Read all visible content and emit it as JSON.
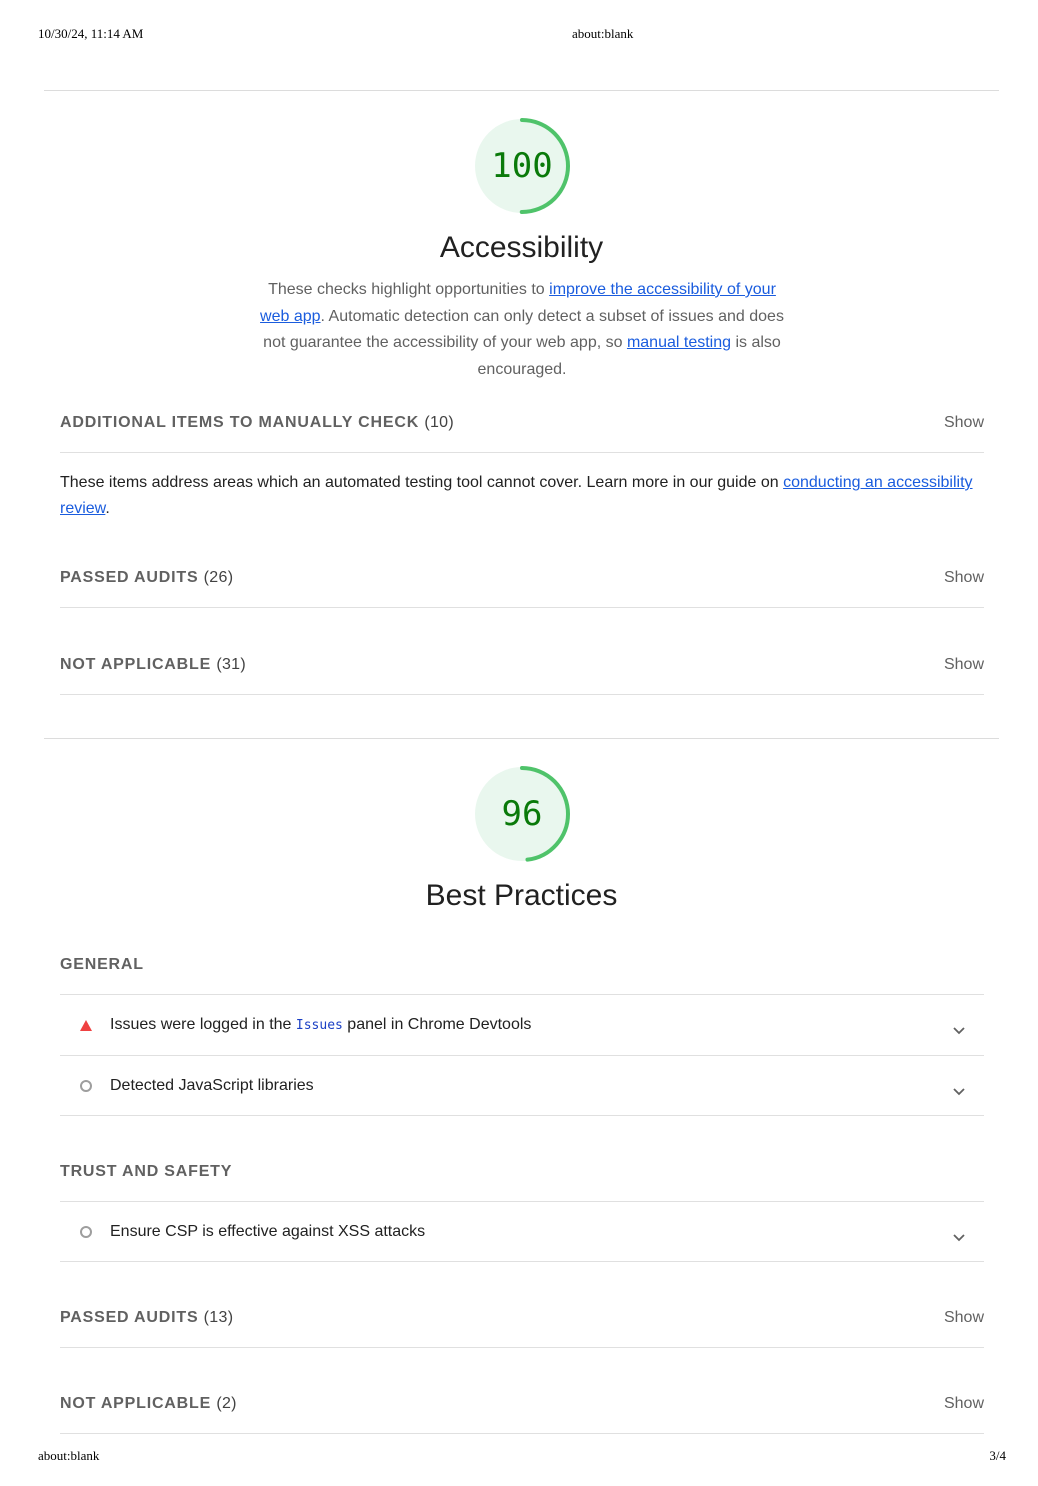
{
  "print_header": {
    "timestamp": "10/30/24, 11:14 AM",
    "url": "about:blank"
  },
  "print_footer": {
    "url": "about:blank",
    "page": "3/4"
  },
  "accessibility": {
    "score": "100",
    "score_fraction": 1.0,
    "title": "Accessibility",
    "desc_1": "These checks highlight opportunities to ",
    "desc_link_1": "improve the accessibility of your web app",
    "desc_2": ". Automatic detection can only detect a subset of issues and does not guarantee the accessibility of your web app, so ",
    "desc_link_2": "manual testing",
    "desc_3": " is also encouraged.",
    "manual": {
      "title": "ADDITIONAL ITEMS TO MANUALLY CHECK",
      "count": "(10)",
      "show": "Show"
    },
    "manual_desc_1": "These items address areas which an automated testing tool cannot cover. Learn more in our guide on ",
    "manual_desc_link": "conducting an accessibility review",
    "manual_desc_2": ".",
    "passed": {
      "title": "PASSED AUDITS",
      "count": "(26)",
      "show": "Show"
    },
    "not_applicable": {
      "title": "NOT APPLICABLE",
      "count": "(31)",
      "show": "Show"
    }
  },
  "best_practices": {
    "score": "96",
    "score_fraction": 0.96,
    "title": "Best Practices",
    "general": "GENERAL",
    "audit_issues_pre": "Issues were logged in the ",
    "audit_issues_code": "Issues",
    "audit_issues_post": " panel in Chrome Devtools",
    "audit_js_libs": "Detected JavaScript libraries",
    "trust_safety": "TRUST AND SAFETY",
    "audit_csp": "Ensure CSP is effective against XSS attacks",
    "passed": {
      "title": "PASSED AUDITS",
      "count": "(13)",
      "show": "Show"
    },
    "not_applicable": {
      "title": "NOT APPLICABLE",
      "count": "(2)",
      "show": "Show"
    }
  },
  "colors": {
    "gauge_fill": "#e9f7ee",
    "gauge_arc": "#4fc36a",
    "score_text": "#0a7a0a",
    "fail_icon": "#ef4141",
    "info_icon": "#9e9e9e",
    "link": "#1a5cde"
  },
  "icons": {
    "fail": "red-triangle-icon",
    "info": "gray-circle-icon",
    "expand": "chevron-down-icon"
  }
}
